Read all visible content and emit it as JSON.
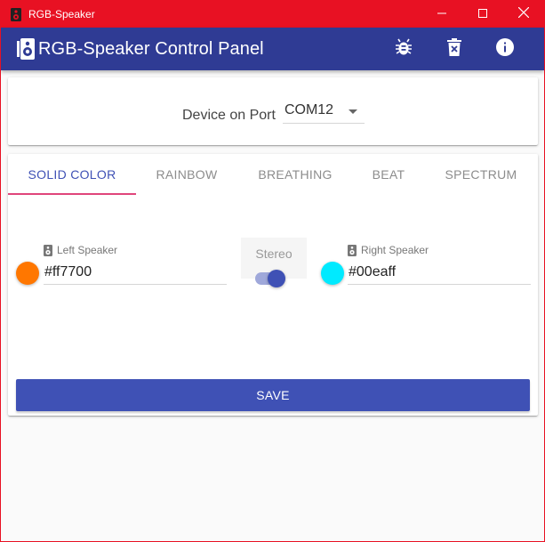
{
  "window": {
    "title": "RGB-Speaker",
    "frame_color": "#e81123",
    "controls": {
      "minimize_icon": "minimize-icon",
      "maximize_icon": "maximize-icon",
      "close_icon": "close-icon"
    }
  },
  "appbar": {
    "title": "RGB-Speaker Control Panel",
    "logo_icon": "speaker-icon",
    "color": "#2f3b94",
    "actions": [
      {
        "name": "debug-button",
        "icon": "bug-icon"
      },
      {
        "name": "delete-button",
        "icon": "delete-icon"
      },
      {
        "name": "info-button",
        "icon": "info-icon"
      }
    ]
  },
  "device": {
    "label": "Device on Port",
    "port": "COM12"
  },
  "tabs": [
    {
      "label": "SOLID COLOR",
      "active": true
    },
    {
      "label": "RAINBOW",
      "active": false
    },
    {
      "label": "BREATHING",
      "active": false
    },
    {
      "label": "BEAT",
      "active": false
    },
    {
      "label": "SPECTRUM",
      "active": false
    }
  ],
  "left": {
    "label": "Left Speaker",
    "value": "#ff7700",
    "color": "#ff7700"
  },
  "right": {
    "label": "Right Speaker",
    "value": "#00eaff",
    "color": "#00eaff"
  },
  "stereo": {
    "label": "Stereo",
    "on": true
  },
  "save": {
    "label": "SAVE"
  },
  "accent": "#3f51b5",
  "tab_indicator_color": "#e0457b"
}
